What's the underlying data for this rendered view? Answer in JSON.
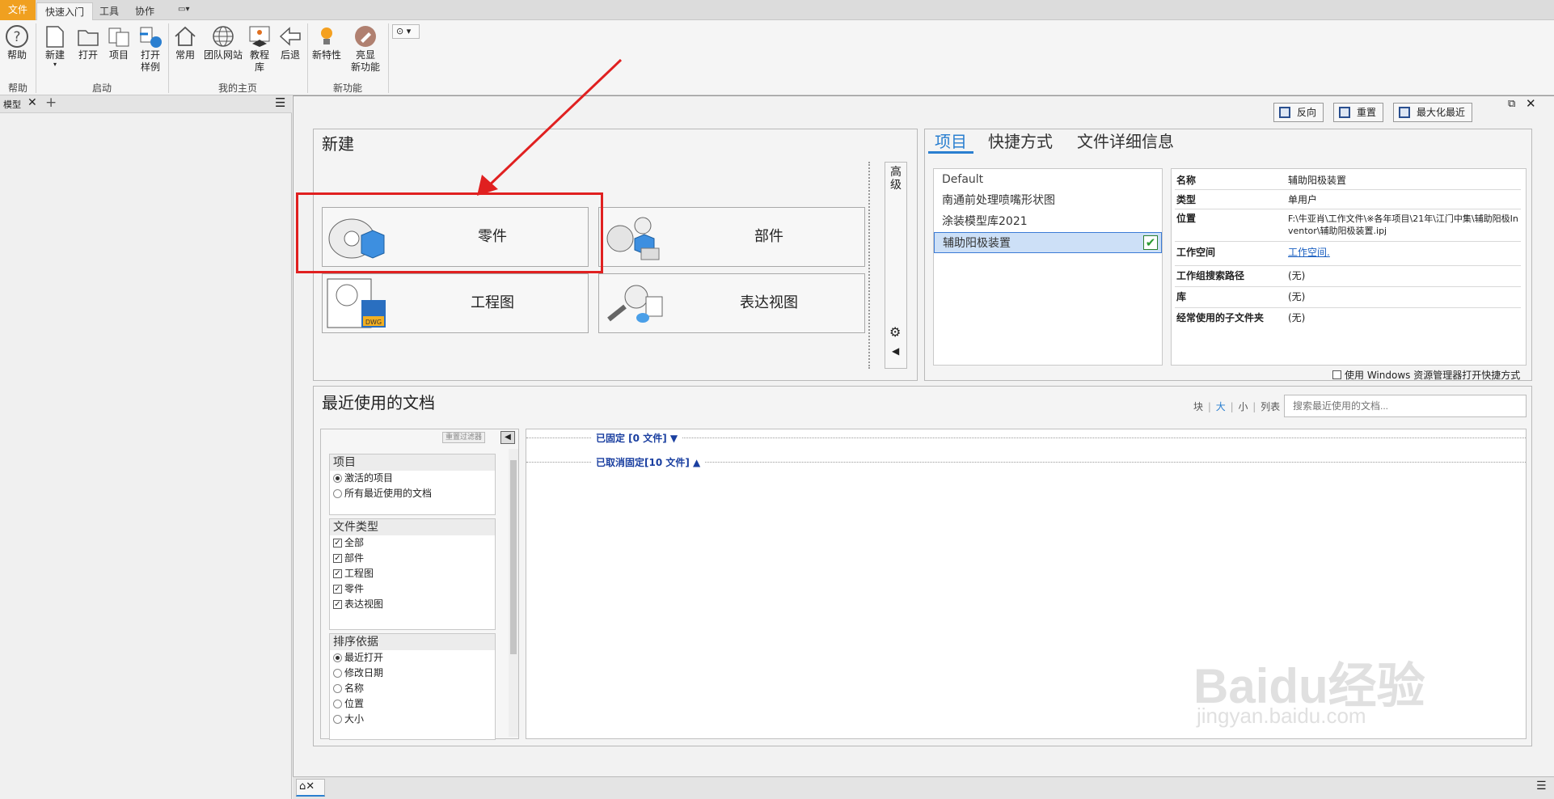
{
  "ribbon_tabs": {
    "file": "文件",
    "quickstart": "快速入门",
    "tools": "工具",
    "collab": "协作"
  },
  "ribbon": {
    "help": "帮助",
    "new": "新建",
    "open": "打开",
    "projects": "项目",
    "open_samples": "打开\n样例",
    "home": "常用",
    "team_web": "团队网站",
    "tutorial": "教程\n库",
    "back": "后退",
    "new_features": "新特性",
    "highlight_line1": "亮显",
    "highlight_line2": "新功能",
    "grp_help": "帮助",
    "grp_launch": "启动",
    "grp_home": "我的主页",
    "grp_new": "新功能"
  },
  "left_panel": {
    "tab": "模型"
  },
  "toolbar": {
    "reverse": "反向",
    "reset": "重置",
    "maximize_recent": "最大化最近"
  },
  "new_panel": {
    "title": "新建",
    "advanced": "高级",
    "part": "零件",
    "assembly": "部件",
    "drawing": "工程图",
    "presentation": "表达视图",
    "dwg_badge": "DWG"
  },
  "project_panel": {
    "tabs": [
      "项目",
      "快捷方式",
      "文件详细信息"
    ],
    "projects": [
      "Default",
      "南通前处理喷嘴形状图",
      "涂装模型库2021",
      "辅助阳极装置"
    ],
    "details": [
      {
        "k": "名称",
        "v": "辅助阳极装置"
      },
      {
        "k": "类型",
        "v": "单用户"
      },
      {
        "k": "位置",
        "v": "F:\\牛亚肖\\工作文件\\※各年项目\\21年\\江门中集\\辅助阳极Inventor\\辅助阳极装置.ipj"
      },
      {
        "k": "工作空间",
        "v": "工作空间."
      },
      {
        "k": "工作组搜索路径",
        "v": "(无)"
      },
      {
        "k": "库",
        "v": "(无)"
      },
      {
        "k": "经常使用的子文件夹",
        "v": "(无)"
      }
    ],
    "windows_explorer": "使用 Windows 资源管理器打开快捷方式"
  },
  "recent": {
    "title": "最近使用的文档",
    "view_block": "块",
    "view_large": "大",
    "view_small": "小",
    "view_list": "列表",
    "view_sep": "|",
    "search_placeholder": "搜索最近使用的文档...",
    "reset_filter": "重置过滤器",
    "pinned": "已固定 [0 文件] ▼",
    "unpinned": "已取消固定[10 文件] ▲",
    "filters": {
      "project_head": "项目",
      "active_project": "激活的项目",
      "all_recent": "所有最近使用的文档",
      "type_head": "文件类型",
      "all": "全部",
      "assembly": "部件",
      "drawing": "工程图",
      "part": "零件",
      "presentation": "表达视图",
      "sort_head": "排序依据",
      "recent_open": "最近打开",
      "modified": "修改日期",
      "name": "名称",
      "location": "位置",
      "size": "大小"
    }
  },
  "watermark": {
    "brand": "Baidu经验",
    "url": "jingyan.baidu.com"
  },
  "colors": {
    "file_tab": "#f0a020",
    "highlight": "#e02020",
    "accent": "#2a7fd0"
  }
}
